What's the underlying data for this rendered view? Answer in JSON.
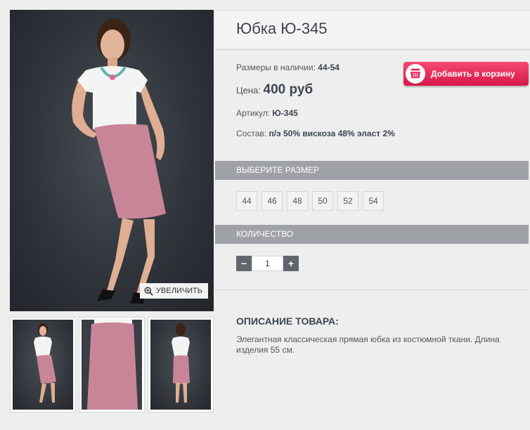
{
  "product": {
    "title": "Юбка Ю-345",
    "sizes_available_label": "Размеры в наличии:",
    "sizes_available_value": "44-54",
    "price_label": "Цена:",
    "price_value": "400 руб",
    "article_label": "Артикул:",
    "article_value": "Ю-345",
    "composition_label": "Состав:",
    "composition_value": "п/э 50% вискоза 48% эласт 2%"
  },
  "cart_button": {
    "label": "Добавить в корзину",
    "icon": "basket-icon",
    "color": "#e8285a"
  },
  "gallery": {
    "zoom_label": "УВЕЛИЧИТЬ",
    "zoom_icon": "magnifier-plus-icon"
  },
  "size_section": {
    "heading": "ВЫБЕРИТЕ РАЗМЕР",
    "options": [
      "44",
      "46",
      "48",
      "50",
      "52",
      "54"
    ]
  },
  "quantity_section": {
    "heading": "КОЛИЧЕСТВО",
    "minus": "−",
    "plus": "+",
    "value": "1"
  },
  "description": {
    "heading": "ОПИСАНИЕ ТОВАРА:",
    "text": "Элегантная классическая прямая юбка из костюмной ткани. Длина изделия 55 см."
  },
  "colors": {
    "section_bar": "#9ea1a6",
    "title_text": "#3d4551",
    "skirt": "#c98598",
    "blouse": "#f4f4f4"
  }
}
